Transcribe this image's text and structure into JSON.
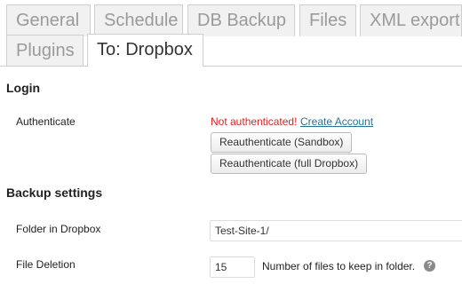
{
  "tabs": [
    {
      "label": "General",
      "active": false
    },
    {
      "label": "Schedule",
      "active": false
    },
    {
      "label": "DB Backup",
      "active": false
    },
    {
      "label": "Files",
      "active": false
    },
    {
      "label": "XML export",
      "active": false
    },
    {
      "label": "Plugins",
      "active": false
    },
    {
      "label": "To: Dropbox",
      "active": true
    }
  ],
  "login": {
    "heading": "Login",
    "authenticate_label": "Authenticate",
    "status_text": "Not authenticated!",
    "create_account_link": "Create Account",
    "reauth_sandbox_button": "Reauthenticate (Sandbox)",
    "reauth_full_button": "Reauthenticate (full Dropbox)"
  },
  "backup_settings": {
    "heading": "Backup settings",
    "folder_label": "Folder in Dropbox",
    "folder_value": "Test-Site-1/",
    "file_deletion_label": "File Deletion",
    "file_deletion_value": "15",
    "file_deletion_description": "Number of files to keep in folder.",
    "help_icon_glyph": "?"
  },
  "colors": {
    "error_text": "#dd2222",
    "link": "#21759b",
    "tab_inactive_bg": "#f1f1f1",
    "tab_border": "#cfcfcf"
  }
}
